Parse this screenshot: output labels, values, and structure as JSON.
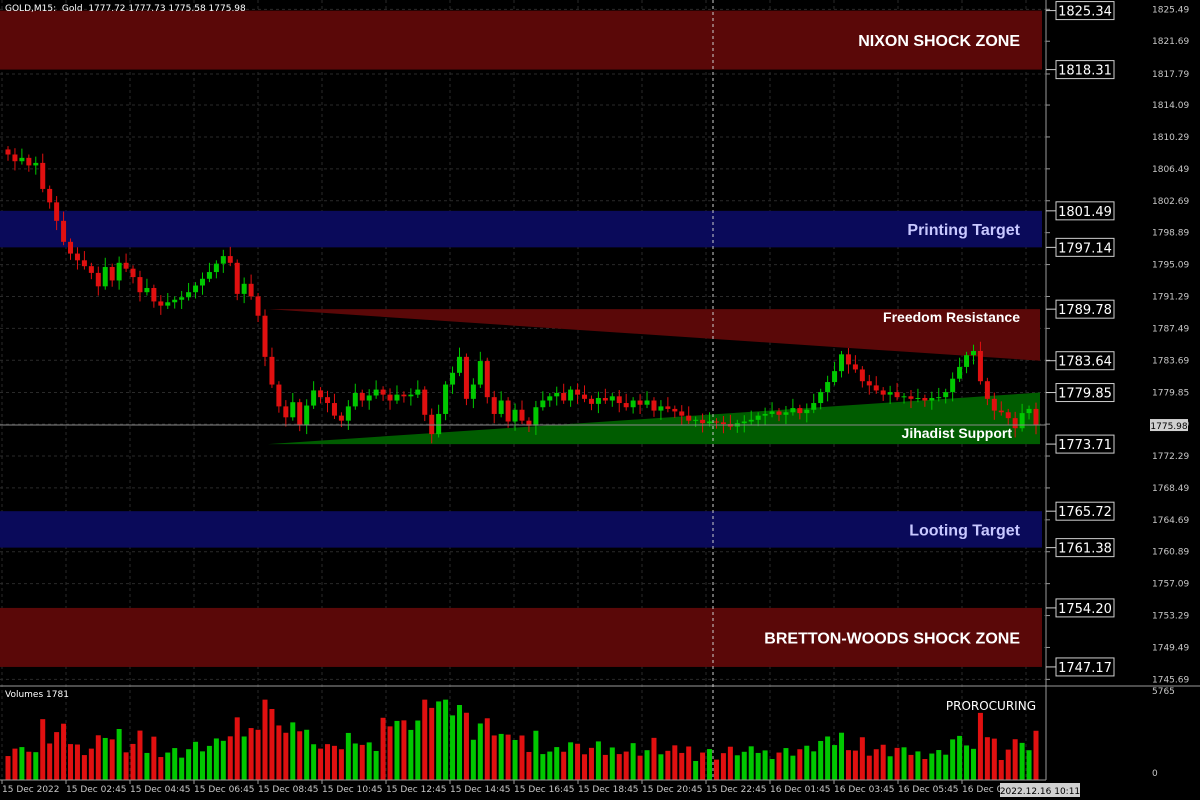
{
  "header": {
    "symbol": "GOLD",
    "timeframe": "M15",
    "description": "Gold",
    "ohlc": "1777.72 1777.73 1775.58 1775.98"
  },
  "volume_pane": {
    "title": "Volumes 1781",
    "indicator_label": "PROROCURING",
    "scale_max": "5765",
    "scale_min": "0"
  },
  "current_price_label": "1775.98",
  "cursor_time_label": "2022.12.16 10:11",
  "colors": {
    "background": "#000000",
    "grid": "#2a2a2a",
    "bull": "#00c800",
    "bear": "#e01010",
    "shock_zone": "#5a0808",
    "target_zone": "#0a0a5a",
    "resistance": "#5a0808",
    "support": "#005c00"
  },
  "zones": [
    {
      "name": "NIXON SHOCK ZONE",
      "high": 1825.34,
      "low": 1818.31,
      "color": "#5a0808",
      "text_color": "#ffffff"
    },
    {
      "name": "Printing Target",
      "high": 1801.49,
      "low": 1797.14,
      "color": "#0a0a5a",
      "text_color": "#c8c8ff"
    },
    {
      "name": "Looting Target",
      "high": 1765.72,
      "low": 1761.38,
      "color": "#0a0a5a",
      "text_color": "#c8c8ff"
    },
    {
      "name": "BRETTON-WOODS SHOCK ZONE",
      "high": 1754.2,
      "low": 1747.17,
      "color": "#5a0808",
      "text_color": "#ffffff"
    }
  ],
  "triangles": [
    {
      "name": "Freedom Resistance",
      "top": 1789.78,
      "bottom_right": 1783.64,
      "color": "#5a0808",
      "text_color": "#ffffff"
    },
    {
      "name": "Jihadist Support",
      "bottom": 1773.71,
      "top_right": 1779.85,
      "color": "#005c00",
      "text_color": "#ffffff"
    }
  ],
  "price_labels": [
    "1825.34",
    "1818.31",
    "1801.49",
    "1797.14",
    "1789.78",
    "1783.64",
    "1779.85",
    "1773.71",
    "1765.72",
    "1761.38",
    "1754.20",
    "1747.17"
  ],
  "chart_data": {
    "type": "candlestick",
    "x_ticks": [
      "15 Dec 2022",
      "15 Dec 02:45",
      "15 Dec 04:45",
      "15 Dec 06:45",
      "15 Dec 08:45",
      "15 Dec 10:45",
      "15 Dec 12:45",
      "15 Dec 14:45",
      "15 Dec 16:45",
      "15 Dec 18:45",
      "15 Dec 20:45",
      "15 Dec 22:45",
      "16 Dec 01:45",
      "16 Dec 03:45",
      "16 Dec 05:45",
      "16 Dec 0"
    ],
    "y_ticks": [
      "1825.49",
      "1821.69",
      "1817.79",
      "1814.09",
      "1810.29",
      "1806.49",
      "1802.69",
      "1798.89",
      "1795.09",
      "1791.29",
      "1787.49",
      "1783.69",
      "1779.85",
      "1776.09",
      "1772.29",
      "1768.49",
      "1764.69",
      "1760.89",
      "1757.09",
      "1753.29",
      "1749.49",
      "1745.69"
    ],
    "ylim": [
      1744.9,
      1826.6
    ],
    "close": [
      1808.2,
      1807.4,
      1807.8,
      1806.9,
      1807.2,
      1804.1,
      1802.5,
      1800.3,
      1797.8,
      1796.4,
      1795.6,
      1794.9,
      1794.1,
      1792.5,
      1794.8,
      1793.2,
      1795.3,
      1794.6,
      1793.6,
      1791.8,
      1792.3,
      1790.7,
      1790.2,
      1790.6,
      1790.9,
      1791.2,
      1791.8,
      1792.6,
      1793.4,
      1794.2,
      1795.2,
      1796.1,
      1795.3,
      1791.6,
      1792.8,
      1791.3,
      1789.0,
      1784.1,
      1780.8,
      1778.2,
      1776.9,
      1778.7,
      1776.0,
      1778.3,
      1780.1,
      1779.3,
      1778.6,
      1777.1,
      1776.5,
      1778.2,
      1779.8,
      1778.9,
      1779.5,
      1780.2,
      1779.6,
      1778.9,
      1779.6,
      1779.4,
      1779.6,
      1780.2,
      1777.2,
      1774.9,
      1777.3,
      1780.8,
      1782.2,
      1784.1,
      1779.1,
      1780.8,
      1783.6,
      1779.3,
      1777.3,
      1778.9,
      1776.4,
      1777.8,
      1776.5,
      1775.9,
      1778.1,
      1778.9,
      1779.4,
      1779.8,
      1778.9,
      1780.2,
      1779.6,
      1779.1,
      1778.5,
      1779.2,
      1778.9,
      1779.4,
      1778.6,
      1778.1,
      1778.9,
      1778.4,
      1778.9,
      1777.7,
      1778.2,
      1777.9,
      1777.6,
      1777.1,
      1776.5,
      1776.6,
      1776.2,
      1776.4,
      1776.3,
      1776.1,
      1775.8,
      1776.2,
      1776.4,
      1776.6,
      1777.1,
      1777.3,
      1777.6,
      1777.2,
      1777.5,
      1778.0,
      1777.4,
      1777.8,
      1778.6,
      1779.9,
      1781.1,
      1782.4,
      1784.4,
      1783.2,
      1782.6,
      1781.2,
      1780.7,
      1780.1,
      1779.6,
      1779.9,
      1779.3,
      1779.4,
      1779.1,
      1779.2,
      1778.9,
      1779.2,
      1779.3,
      1779.9,
      1781.5,
      1782.9,
      1784.3,
      1784.8,
      1781.2,
      1779.1,
      1777.7,
      1777.5,
      1776.8,
      1775.6,
      1777.4,
      1777.9,
      1775.98
    ],
    "volume_max": 5765
  }
}
